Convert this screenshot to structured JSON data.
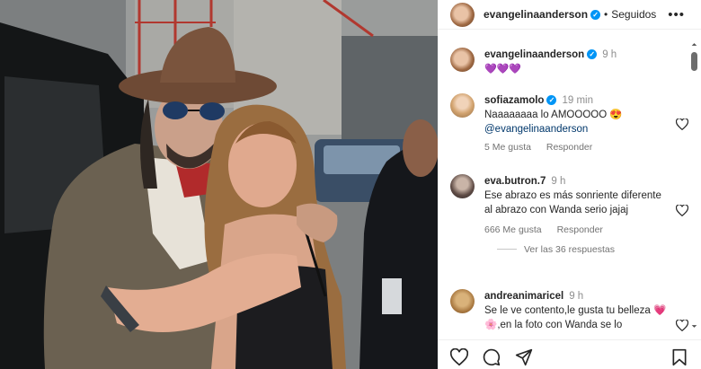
{
  "header": {
    "username": "evangelinaanderson",
    "separator": "•",
    "follow_status": "Seguidos",
    "more_icon": "ellipsis-icon"
  },
  "caption": {
    "username": "evangelinaanderson",
    "time": "9 h",
    "text": "💜💜💜"
  },
  "comments": [
    {
      "username": "sofiazamolo",
      "time": "19 min",
      "text": "Naaaaaaaa lo AMOOOOO 😍",
      "mention": "@evangelinaanderson",
      "likes": "5 Me gusta",
      "reply": "Responder"
    },
    {
      "username": "eva.butron.7",
      "time": "9 h",
      "text": "Ese abrazo es más sonriente diferente al abrazo con Wanda serio jajaj",
      "likes": "666 Me gusta",
      "reply": "Responder",
      "view_replies": "Ver las 36 respuestas"
    },
    {
      "username": "andreanimaricel",
      "time": "9 h",
      "text": "Se le ve contento,le gusta tu belleza 💗🌸,en la foto con Wanda se lo"
    }
  ],
  "actions": {
    "like_icon": "heart-icon",
    "comment_icon": "comment-icon",
    "share_icon": "share-icon",
    "save_icon": "bookmark-icon"
  },
  "colors": {
    "verified": "#0095f6",
    "mention": "#00376b",
    "muted": "#737373"
  }
}
